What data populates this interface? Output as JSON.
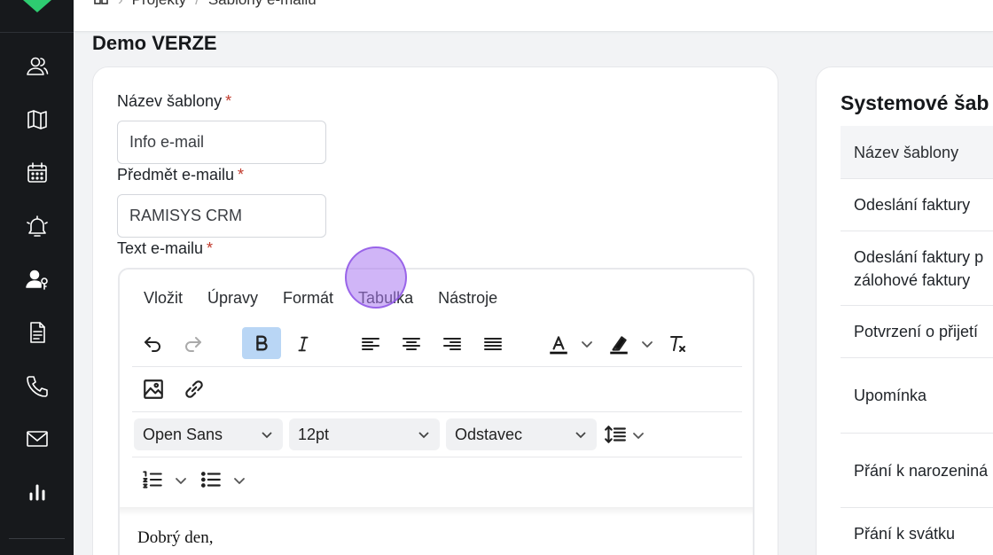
{
  "breadcrumb": {
    "items": [
      "Projekty",
      "Šablony e-mailů"
    ]
  },
  "page": {
    "title": "Demo VERZE"
  },
  "form": {
    "template_name_label": "Název šablony",
    "template_name_value": "Info e-mail",
    "subject_label": "Předmět e-mailu",
    "subject_value": "RAMISYS CRM",
    "body_label": "Text e-mailu",
    "required_mark": "*"
  },
  "editor": {
    "menu": [
      "Vložit",
      "Úpravy",
      "Formát",
      "Tabulka",
      "Nástroje"
    ],
    "font_family": "Open Sans",
    "font_size": "12pt",
    "block_format": "Odstavec",
    "content": "Dobrý den,"
  },
  "system_templates": {
    "title": "Systemové šab",
    "column": "Název šablony",
    "rows": [
      [
        "Odeslání faktury"
      ],
      [
        "Odeslání faktury p",
        "zálohové faktury"
      ],
      [
        "Potvrzení o přijetí"
      ],
      [
        "Upomínka"
      ],
      [
        "Přání k narozeniná"
      ],
      [
        "Přání k svátku"
      ]
    ]
  },
  "colors": {
    "sidebar": "#17191c",
    "accent_active": "#b9d6f5",
    "required": "#c0392b",
    "cursor": "#aa78f0"
  }
}
